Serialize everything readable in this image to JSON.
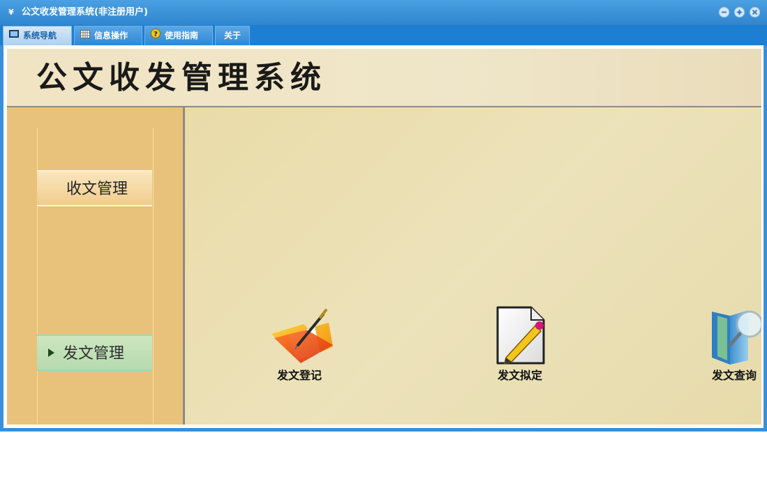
{
  "window": {
    "title": "公文收发管理系统(非注册用户)",
    "app_icon_text": "¥"
  },
  "menu": {
    "tabs": [
      {
        "label": "系统导航",
        "icon": "monitor-icon",
        "active": true
      },
      {
        "label": "信息操作",
        "icon": "grid-icon",
        "active": false
      },
      {
        "label": "使用指南",
        "icon": "help-icon",
        "active": false
      },
      {
        "label": "关于",
        "icon": "",
        "active": false
      }
    ]
  },
  "header": {
    "title": "公文收发管理系统"
  },
  "sidebar": {
    "items": [
      {
        "label": "收文管理",
        "selected": false
      },
      {
        "label": "发文管理",
        "selected": true
      }
    ]
  },
  "main": {
    "functions": [
      {
        "label": "发文登记",
        "icon": "folder-pen-icon"
      },
      {
        "label": "发文拟定",
        "icon": "document-pencil-icon"
      },
      {
        "label": "发文查询",
        "icon": "book-magnifier-icon"
      }
    ]
  },
  "colors": {
    "titlebar": "#3a8fd6",
    "menubar": "#1c7fd1",
    "sidebar": "#e8c27a",
    "main_bg": "#ece2bb",
    "selected_item": "#b7dab0"
  }
}
